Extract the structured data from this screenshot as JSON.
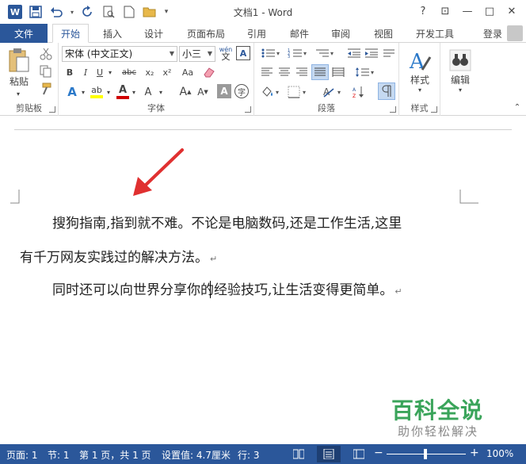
{
  "window": {
    "title": "文档1 - Word",
    "help": "?",
    "ribbon_display": "⊡",
    "minimize": "—",
    "maximize": "□",
    "close": "✕"
  },
  "qat": {
    "logo": "W",
    "customize": "▾"
  },
  "tabs": {
    "file": "文件",
    "items": [
      "开始",
      "插入",
      "设计",
      "页面布局",
      "引用",
      "邮件",
      "审阅",
      "视图",
      "开发工具"
    ],
    "active": "开始",
    "signin": "登录"
  },
  "ribbon": {
    "clipboard": {
      "paste": "粘贴",
      "label": "剪贴板"
    },
    "font": {
      "font_name": "宋体 (中文正文)",
      "font_size": "小三",
      "wen": "wén",
      "bold": "B",
      "italic": "I",
      "underline": "U",
      "strike": "abc",
      "sub": "x₂",
      "sup": "x²",
      "aa": "Aa",
      "label": "字体"
    },
    "paragraph": {
      "label": "段落"
    },
    "styles": {
      "button": "样式",
      "label": "样式"
    },
    "editing": {
      "button": "编辑"
    }
  },
  "document": {
    "para1_line1": "搜狗指南,指到就不难。不论是电脑数码,还是工作生活,这里",
    "para1_line2": "有千万网友实践过的解决方法。",
    "para2": "同时还可以向世界分享你的经验技巧,让生活变得更简单。",
    "para_mark": "↵"
  },
  "status": {
    "page": "页面: 1",
    "section": "节: 1",
    "page_of": "第 1 页，共 1 页",
    "position": "设置值: 4.7厘米",
    "line": "行: 3",
    "zoom": "100%",
    "zoom_minus": "−",
    "zoom_plus": "+"
  },
  "watermark": {
    "line1": "百科全说",
    "line2": "助你轻松解决"
  },
  "colors": {
    "accent": "#2b579a",
    "watermark_green": "#3aa45a",
    "arrow_red": "#e03030",
    "highlight_yellow": "#ffff00",
    "font_red": "#d00000"
  }
}
